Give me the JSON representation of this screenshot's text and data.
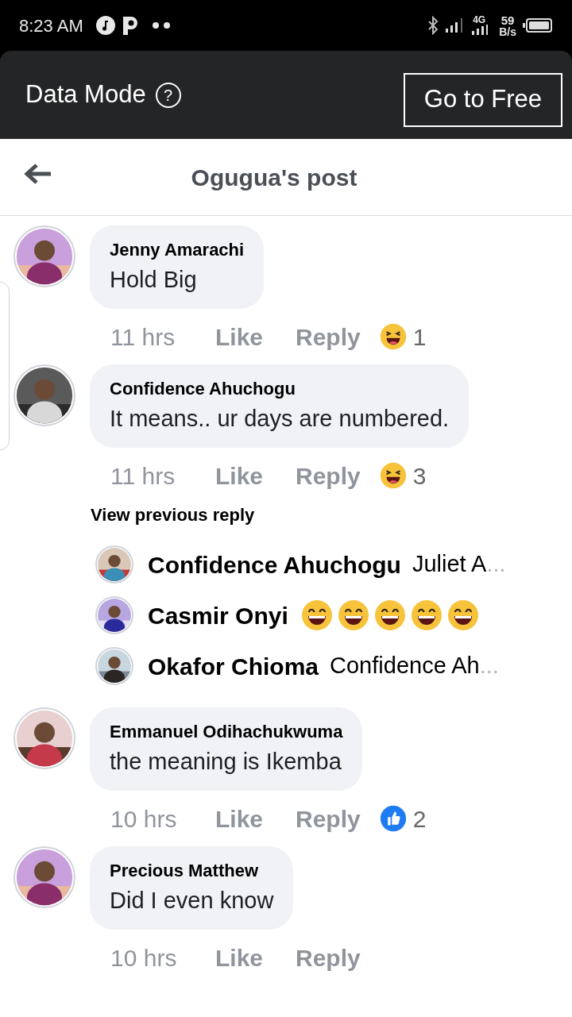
{
  "status_bar": {
    "time": "8:23 AM",
    "network": "4G",
    "speed_value": "59",
    "speed_unit": "B/s"
  },
  "data_banner": {
    "label": "Data Mode",
    "help": "?",
    "button": "Go to Free"
  },
  "header": {
    "title": "Ogugua's post"
  },
  "comments": [
    {
      "author": "Jenny Amarachi",
      "text": "Hold Big",
      "time": "11 hrs",
      "like": "Like",
      "reply": "Reply",
      "reaction": {
        "kind": "haha",
        "count": "1"
      }
    },
    {
      "author": "Confidence Ahuchogu",
      "text": "It means.. ur days are numbered.",
      "time": "11 hrs",
      "like": "Like",
      "reply": "Reply",
      "reaction": {
        "kind": "haha",
        "count": "3"
      },
      "replies": {
        "link": "View previous reply",
        "items": [
          {
            "author": "Confidence Ahuchogu",
            "text": "Juliet A",
            "ellipsis": "..."
          },
          {
            "author": "Casmir Onyi",
            "emojis": [
              {
                "kind": "grin"
              },
              {
                "kind": "grin"
              },
              {
                "kind": "grin"
              },
              {
                "kind": "grin"
              },
              {
                "kind": "grin"
              }
            ]
          },
          {
            "author": "Okafor Chioma",
            "text": "Confidence Ah",
            "ellipsis": "..."
          }
        ]
      }
    },
    {
      "author": "Emmanuel Odihachukwuma",
      "text": "the meaning is Ikemba",
      "time": "10 hrs",
      "like": "Like",
      "reply": "Reply",
      "reaction": {
        "kind": "like",
        "count": "2"
      }
    },
    {
      "author": "Precious Matthew",
      "text": "Did I even know",
      "time": "10 hrs",
      "like": "Like",
      "reply": "Reply"
    }
  ]
}
